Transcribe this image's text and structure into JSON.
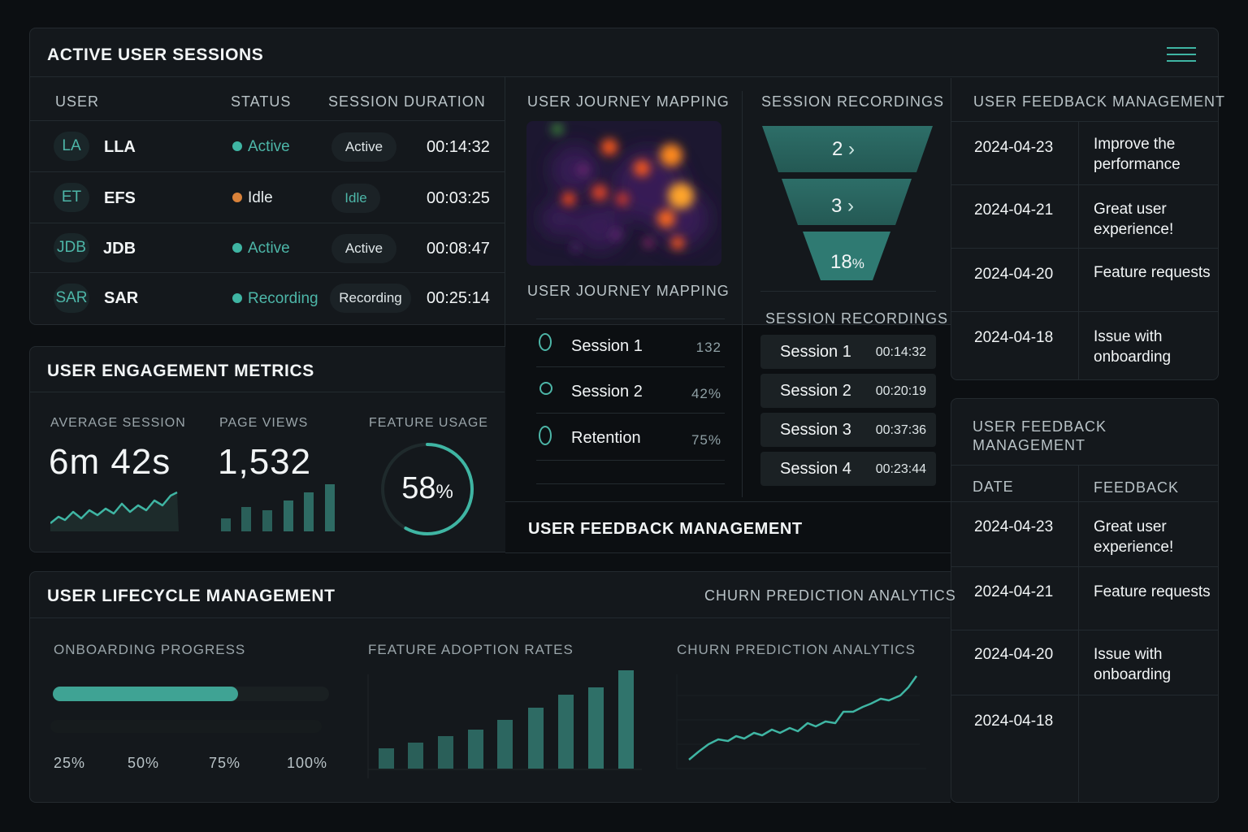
{
  "sessions": {
    "title": "ACTIVE USER SESSIONS",
    "columns": [
      "USER",
      "STATUS",
      "SESSION DURATION"
    ],
    "rows": [
      {
        "initials": "LA",
        "name": "LLA",
        "status": "Active",
        "badge": "Active",
        "duration": "00:14:32",
        "status_color": "#3fb5a3"
      },
      {
        "initials": "ET",
        "name": "EFS",
        "status": "Idle",
        "badge": "Idle",
        "duration": "00:03:25",
        "status_color": "#d9823a"
      },
      {
        "initials": "JDB",
        "name": "JDB",
        "status": "Active",
        "badge": "Active",
        "duration": "00:08:47",
        "status_color": "#3fb5a3"
      },
      {
        "initials": "SAR",
        "name": "SAR",
        "status": "Recording",
        "badge": "Recording",
        "duration": "00:25:14",
        "status_color": "#3fb5a3"
      }
    ]
  },
  "journey": {
    "title_top": "USER JOURNEY MAPPING",
    "title_bottom": "USER JOURNEY MAPPING",
    "rows": [
      {
        "name": "Session 1",
        "value": "132"
      },
      {
        "name": "Session 2",
        "value": "42%"
      },
      {
        "name": "Retention",
        "value": "75%"
      }
    ]
  },
  "recordings": {
    "title_top": "SESSION RECORDINGS",
    "title_bottom": "SESSION RECORDINGS",
    "funnel": [
      "2",
      "3",
      "18"
    ],
    "funnel_unit": "%",
    "rows": [
      {
        "name": "Session 1",
        "time": "00:14:32"
      },
      {
        "name": "Session 2",
        "time": "00:20:19"
      },
      {
        "name": "Session 3",
        "time": "00:37:36"
      },
      {
        "name": "Session 4",
        "time": "00:23:44"
      }
    ]
  },
  "feedback_top": {
    "title": "USER FEEDBACK MANAGEMENT",
    "rows": [
      {
        "date": "2024-04-23",
        "text": "Improve the performance"
      },
      {
        "date": "2024-04-21",
        "text": "Great user experience!"
      },
      {
        "date": "2024-04-20",
        "text": "Feature requests"
      },
      {
        "date": "2024-04-18",
        "text": "Issue with onboarding"
      }
    ]
  },
  "feedback_bottom": {
    "title": "USER FEEDBACK MANAGEMENT",
    "col_date": "DATE",
    "col_feedback": "FEEDBACK",
    "rows": [
      {
        "date": "2024-04-23",
        "text": "Great user experience!"
      },
      {
        "date": "2024-04-21",
        "text": "Feature requests"
      },
      {
        "date": "2024-04-20",
        "text": "Issue with onboarding"
      },
      {
        "date": "2024-04-18",
        "text": ""
      }
    ]
  },
  "feedback_center_title": "USER FEEDBACK MANAGEMENT",
  "engagement": {
    "title": "USER ENGAGEMENT METRICS",
    "avg_label": "AVERAGE SESSION",
    "avg_value": "6m 42s",
    "views_label": "PAGE VIEWS",
    "views_value": "1,532",
    "usage_label": "FEATURE USAGE",
    "usage_value": "58",
    "usage_unit": "%",
    "usage_fraction": 0.58
  },
  "lifecycle": {
    "title": "USER LIFECYCLE MANAGEMENT",
    "right_title": "CHURN PREDICTION ANALYTICS",
    "onboarding_label": "ONBOARDING PROGRESS",
    "onboarding_fraction": 0.67,
    "ticks": [
      "25%",
      "50%",
      "75%",
      "100%"
    ],
    "adoption_label": "FEATURE ADOPTION RATES",
    "churn_label": "CHURN PREDICTION ANALYTICS"
  },
  "colors": {
    "accent": "#3fb5a3",
    "panel": "#14181c",
    "background": "#0c0f12"
  }
}
